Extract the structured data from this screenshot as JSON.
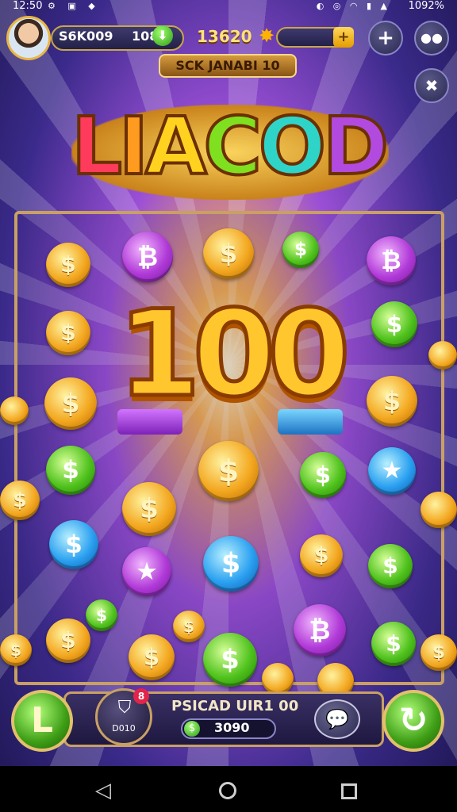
{
  "status_bar": {
    "time": "12:50",
    "battery": "1092%",
    "left_icons": "⚙ ▣ ◆",
    "right_icons": "◐ ◎ ◠ ▮ ▲"
  },
  "header": {
    "player_name": "S6K009",
    "player_level": "108",
    "gold_count": "13620",
    "plus_symbol": "+",
    "banner": "SCK JANABI 10"
  },
  "logo": {
    "letters": [
      "L",
      "I",
      "A",
      "C",
      "O",
      "D"
    ],
    "colors": [
      "#ff3b5c",
      "#ff9b1f",
      "#ffd21f",
      "#7fe020",
      "#2fd4c8",
      "#b24ae0"
    ]
  },
  "board": {
    "center_number": "100"
  },
  "bottom": {
    "left_button_glyph": "L",
    "shield_label": "D010",
    "badge": "8",
    "panel_title": "PSICAD UIR1 00",
    "panel_value": "3090",
    "right_button_glyph": "↻"
  },
  "icons": {
    "plus": "plus-icon",
    "controller": "gamepad-icon",
    "close": "x-icon",
    "chat": "chat-icon",
    "shield": "shield-icon"
  }
}
